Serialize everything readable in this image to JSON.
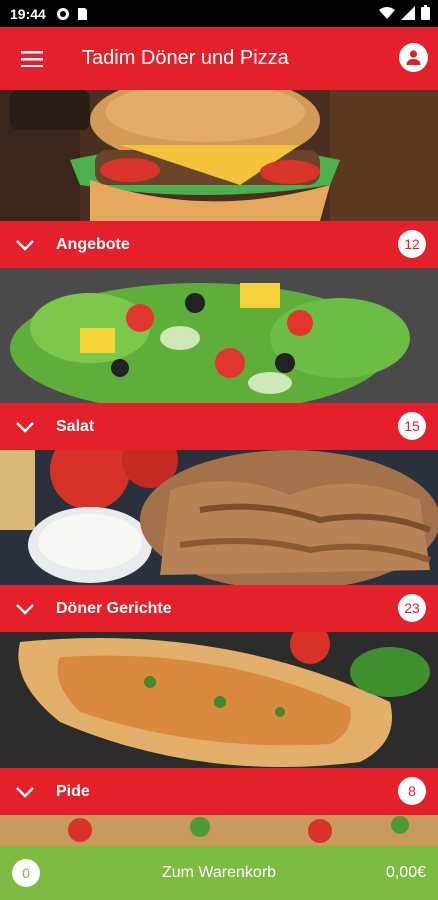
{
  "status": {
    "time": "19:44"
  },
  "header": {
    "title": "Tadim Döner und Pizza"
  },
  "sections": [
    {
      "label": "Angebote",
      "count": "12"
    },
    {
      "label": "Salat",
      "count": "15"
    },
    {
      "label": "Döner Gerichte",
      "count": "23"
    },
    {
      "label": "Pide",
      "count": "8"
    }
  ],
  "cart": {
    "count": "0",
    "label": "Zum Warenkorb",
    "total": "0,00€"
  },
  "colors": {
    "brand": "#e4212b",
    "cart": "#7dbb42"
  },
  "icons": [
    "menu-icon",
    "profile-icon",
    "chevron-down-icon"
  ]
}
